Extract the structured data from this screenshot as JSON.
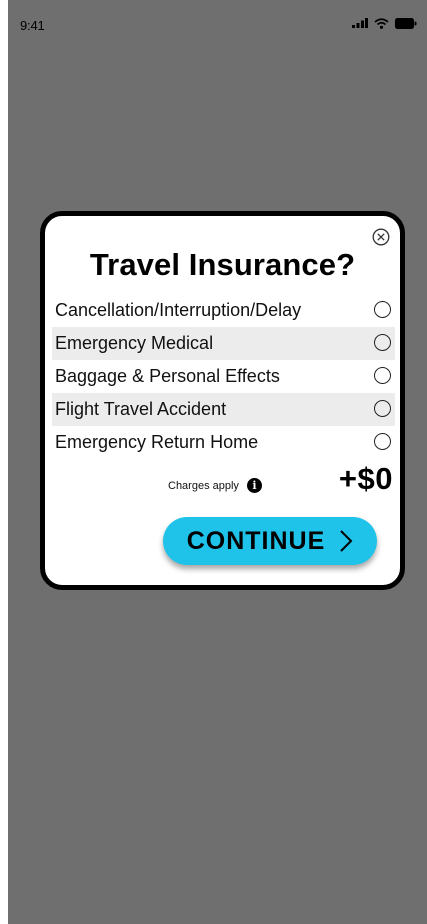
{
  "status_bar": {
    "time": "9:41",
    "icons": [
      "signal-icon",
      "wifi-icon",
      "battery-icon"
    ]
  },
  "modal": {
    "title": "Travel Insurance?",
    "close_icon": "close-circle-icon",
    "options": [
      {
        "label": "Cancellation/Interruption/Delay",
        "selected": false
      },
      {
        "label": "Emergency Medical",
        "selected": false
      },
      {
        "label": "Baggage & Personal Effects",
        "selected": false
      },
      {
        "label": "Flight Travel Accident",
        "selected": false
      },
      {
        "label": "Emergency Return Home",
        "selected": false
      }
    ],
    "charges_text": "Charges apply",
    "info_icon": "info-icon",
    "price": "+$0",
    "continue_label": "CONTINUE",
    "continue_icon": "chevron-right-icon"
  },
  "colors": {
    "backdrop": "#6f6f6f",
    "continue_button": "#1fc2e8",
    "row_shade": "#ececec"
  }
}
